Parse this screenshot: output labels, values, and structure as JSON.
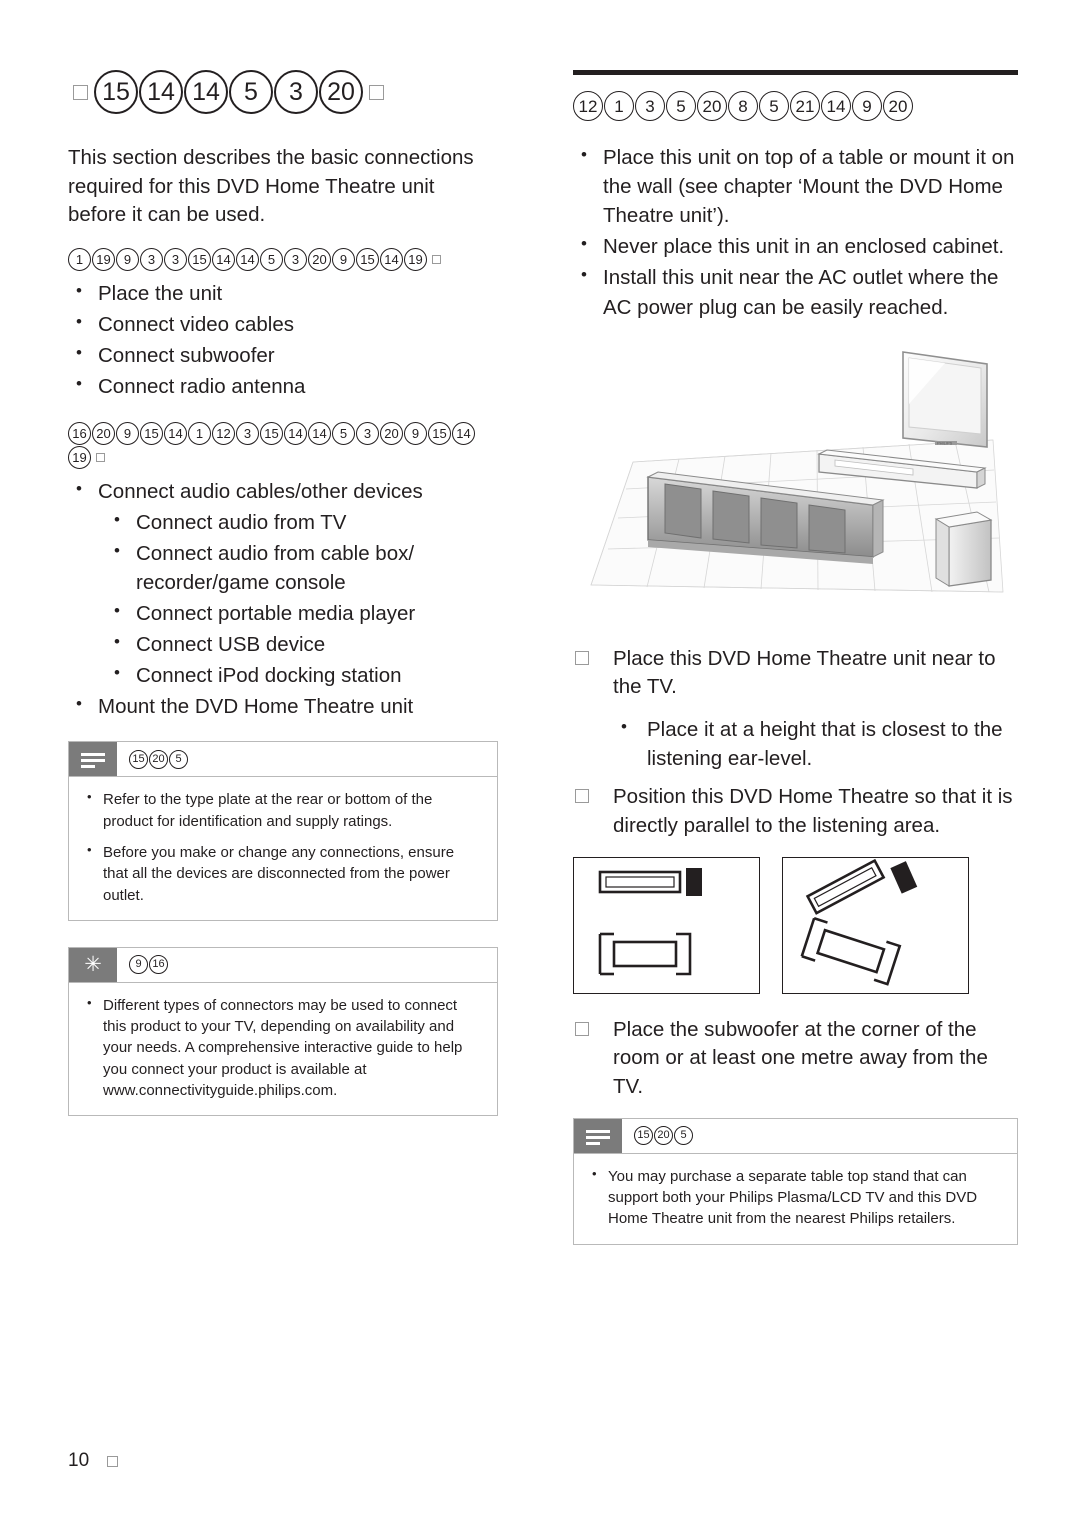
{
  "page": {
    "number": "10"
  },
  "left": {
    "title_glyphs": [
      "sq",
      "15",
      "14",
      "14",
      "5",
      "3",
      "20",
      "sq"
    ],
    "intro": "This section describes the basic connections required for this DVD Home Theatre unit before it can be used.",
    "section1": {
      "heading_glyphs": [
        "1",
        "19",
        "9",
        "3",
        "3",
        "15",
        "14",
        "14",
        "5",
        "3",
        "20",
        "9",
        "15",
        "14",
        "19",
        "sq"
      ],
      "items": [
        {
          "text": "Place the unit",
          "indent": false
        },
        {
          "text": "Connect video cables",
          "indent": false
        },
        {
          "text": "Connect subwoofer",
          "indent": false
        },
        {
          "text": "Connect radio antenna",
          "indent": false
        }
      ]
    },
    "section2": {
      "heading_glyphs": [
        "16",
        "20",
        "9",
        "15",
        "14",
        "1",
        "12",
        "3",
        "15",
        "14",
        "14",
        "5",
        "3",
        "20",
        "9",
        "15",
        "14",
        "19",
        "sq"
      ],
      "items": [
        {
          "text": "Connect audio cables/other devices",
          "indent": false
        },
        {
          "text": "Connect audio from TV",
          "indent": true
        },
        {
          "text": "Connect audio from cable box/ recorder/game console",
          "indent": true
        },
        {
          "text": "Connect portable media player",
          "indent": true
        },
        {
          "text": "Connect USB device",
          "indent": true
        },
        {
          "text": "Connect iPod docking station",
          "indent": true
        },
        {
          "text": "Mount the DVD Home Theatre unit",
          "indent": false
        }
      ]
    },
    "note_box": {
      "icon": "note-icon",
      "head_glyphs": [
        "15",
        "20",
        "5"
      ],
      "items": [
        "Refer to the type plate at the rear or bottom of the product for identification and supply ratings.",
        "Before you make or change any connections, ensure that all the devices are disconnected from the power outlet."
      ]
    },
    "tip_box": {
      "icon": "tip-star-icon",
      "head_glyphs": [
        "9",
        "16"
      ],
      "items": [
        "Different types of connectors may be used to connect this product to your TV, depending on availability and your needs. A comprehensive interactive guide to help you connect your product is available at www.connectivityguide.philips.com."
      ]
    }
  },
  "right": {
    "title_glyphs": [
      "12",
      "1",
      "3",
      "5",
      "20",
      "8",
      "5",
      "21",
      "14",
      "9",
      "20"
    ],
    "bullets": [
      "Place this unit on top of a table or mount it on the wall (see chapter ‘Mount the DVD Home Theatre unit’).",
      "Never place this unit in an enclosed cabinet.",
      "Install this unit near the AC outlet where the AC power plug can be easily reached."
    ],
    "steps_a": [
      {
        "text": "Place this DVD Home Theatre unit near to the TV.",
        "sub": false
      },
      {
        "text": "Place it at a height that is closest to the listening ear-level.",
        "sub": true
      },
      {
        "text": "Position this DVD Home Theatre so that it is directly parallel to the listening area.",
        "sub": false
      }
    ],
    "steps_b": [
      {
        "text": "Place the subwoofer at the corner of the room or at least one metre away from the TV.",
        "sub": false
      }
    ],
    "note_box": {
      "icon": "note-icon",
      "head_glyphs": [
        "15",
        "20",
        "5"
      ],
      "items": [
        "You may purchase a separate table top stand that can support both your Philips Plasma/LCD TV and this DVD Home Theatre unit from the nearest Philips retailers."
      ]
    }
  },
  "illustrations": {
    "room": "room-with-tv-soundbar-subwoofer",
    "placement_left": "top-view-parallel-layout",
    "placement_right": "top-view-angled-layout"
  }
}
